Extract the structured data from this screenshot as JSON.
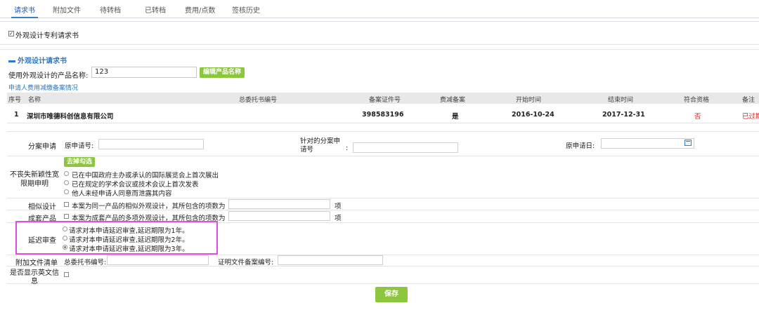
{
  "tabs": [
    {
      "label": "请求书",
      "active": true
    },
    {
      "label": "附加文件"
    },
    {
      "label": "待转档"
    },
    {
      "label": "已转档"
    },
    {
      "label": "费用/点数"
    },
    {
      "label": "签核历史"
    }
  ],
  "form_type": {
    "label": "外观设计专利请求书",
    "checked": true
  },
  "section": {
    "title": "外观设计请求书",
    "product_label": "使用外观设计的产品名称:",
    "product_value": "123",
    "edit_button": "编辑产品名称",
    "applicant_subhead": "申请人费用减缴备案情况"
  },
  "applicant_table": {
    "headers": [
      "序号",
      "名称",
      "总委托书编号",
      "备案证件号",
      "费减备案",
      "开始时间",
      "结束时间",
      "符合资格",
      "备注"
    ],
    "rows": [
      {
        "no": "1",
        "name": "深圳市唯德科创信息有限公司",
        "cert": "398583196",
        "reduce": "是",
        "start": "2016-10-24",
        "end": "2017-12-31",
        "qualified": "否",
        "note": "已过期"
      }
    ]
  },
  "division": {
    "label": "分案申请",
    "orig_no_label": "原申请号:",
    "target_no_label_1": "针对的分案申",
    "target_no_label_2": "请号",
    "target_colon": ":",
    "orig_date_label": "原申请日:"
  },
  "novelty": {
    "label_1": "不丧失新颖性宽",
    "label_2": "限期申明",
    "clear_button": "去掉勾选",
    "options": [
      "已在中国政府主办或承认的国际展览会上首次展出",
      "已在规定的学术会议或技术会议上首次发表",
      "他人未经申请人同意而泄露其内容"
    ]
  },
  "similar": {
    "label": "相似设计",
    "text": "本案为同一产品的相似外观设计，其所包含的项数为",
    "unit": "项"
  },
  "set_product": {
    "label": "成套产品",
    "text": "本案为成套产品的多项外观设计，其所包含的项数为",
    "unit": "项"
  },
  "delay": {
    "label": "延迟审查",
    "options": [
      {
        "text": "请求对本申请延迟审查,延迟期限为1年。",
        "selected": false
      },
      {
        "text": "请求对本申请延迟审查,延迟期限为2年。",
        "selected": false
      },
      {
        "text": "请求对本申请延迟审查,延迟期限为3年。",
        "selected": true
      }
    ]
  },
  "attachments": {
    "label": "附加文件清单",
    "power_label": "总委托书编号:",
    "cert_label": "证明文件备案编号:"
  },
  "english": {
    "label_1": "是否显示英文信",
    "label_2": "息"
  },
  "save_button": "保存",
  "colors": {
    "accent": "#2f78c4",
    "button_green": "#8cc63e",
    "highlight": "#e04ee0",
    "warning_red": "#e02020"
  }
}
